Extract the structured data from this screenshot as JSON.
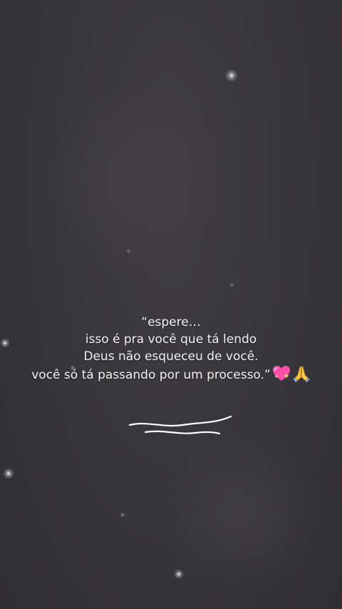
{
  "quote": {
    "line1": "“espere…",
    "line2": "isso é pra você que tá lendo",
    "line3": "Deus não esqueceu de você.",
    "line4": "você só tá passando por um processo.”"
  },
  "icons": {
    "emoji1": "sparkling-heart-icon",
    "emoji2": "folded-hands-icon",
    "decoration": "wavy-lines-icon"
  },
  "colors": {
    "background": "#38373b",
    "text": "#f2f2f2",
    "heart": "#ff4fa8"
  }
}
